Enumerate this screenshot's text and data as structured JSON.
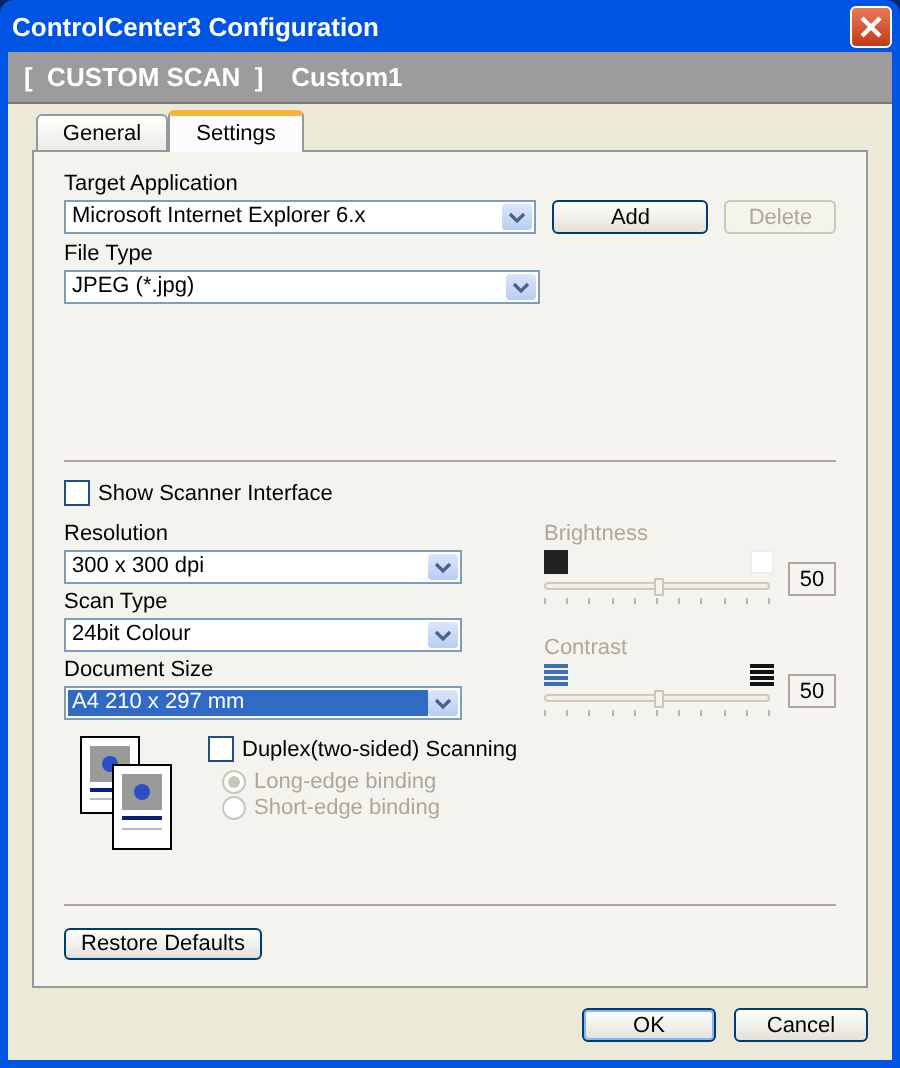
{
  "window": {
    "title": "ControlCenter3 Configuration"
  },
  "header": {
    "category": "[  CUSTOM SCAN  ]",
    "name": "Custom1"
  },
  "tabs": [
    {
      "label": "General",
      "selected": false
    },
    {
      "label": "Settings",
      "selected": true
    }
  ],
  "target_application": {
    "label": "Target Application",
    "value": "Microsoft Internet Explorer 6.x"
  },
  "app_buttons": [
    {
      "label": "Add",
      "disabled": false
    },
    {
      "label": "Delete",
      "disabled": true
    }
  ],
  "file_type": {
    "label": "File Type",
    "value": "JPEG (*.jpg)"
  },
  "show_scanner_interface": {
    "label": "Show Scanner Interface",
    "checked": false
  },
  "fields": [
    {
      "label": "Resolution",
      "value": "300 x 300 dpi",
      "selected": false
    },
    {
      "label": "Scan Type",
      "value": "24bit Colour",
      "selected": false
    },
    {
      "label": "Document Size",
      "value": "A4 210 x 297 mm",
      "selected": true
    }
  ],
  "sliders": [
    {
      "kind": "brightness",
      "label": "Brightness",
      "level": 0.5,
      "reading": "50",
      "disabled": true
    },
    {
      "kind": "contrast",
      "label": "Contrast",
      "level": 0.5,
      "reading": "50",
      "disabled": true
    }
  ],
  "duplex": {
    "label": "Duplex(two-sided) Scanning",
    "checked": false,
    "options": [
      {
        "label": "Long-edge binding",
        "selected": true,
        "disabled": true
      },
      {
        "label": "Short-edge binding",
        "selected": false,
        "disabled": true
      }
    ]
  },
  "restore_button": "Restore Defaults",
  "footer_buttons": [
    {
      "label": "OK",
      "default": true
    },
    {
      "label": "Cancel",
      "default": false
    }
  ]
}
